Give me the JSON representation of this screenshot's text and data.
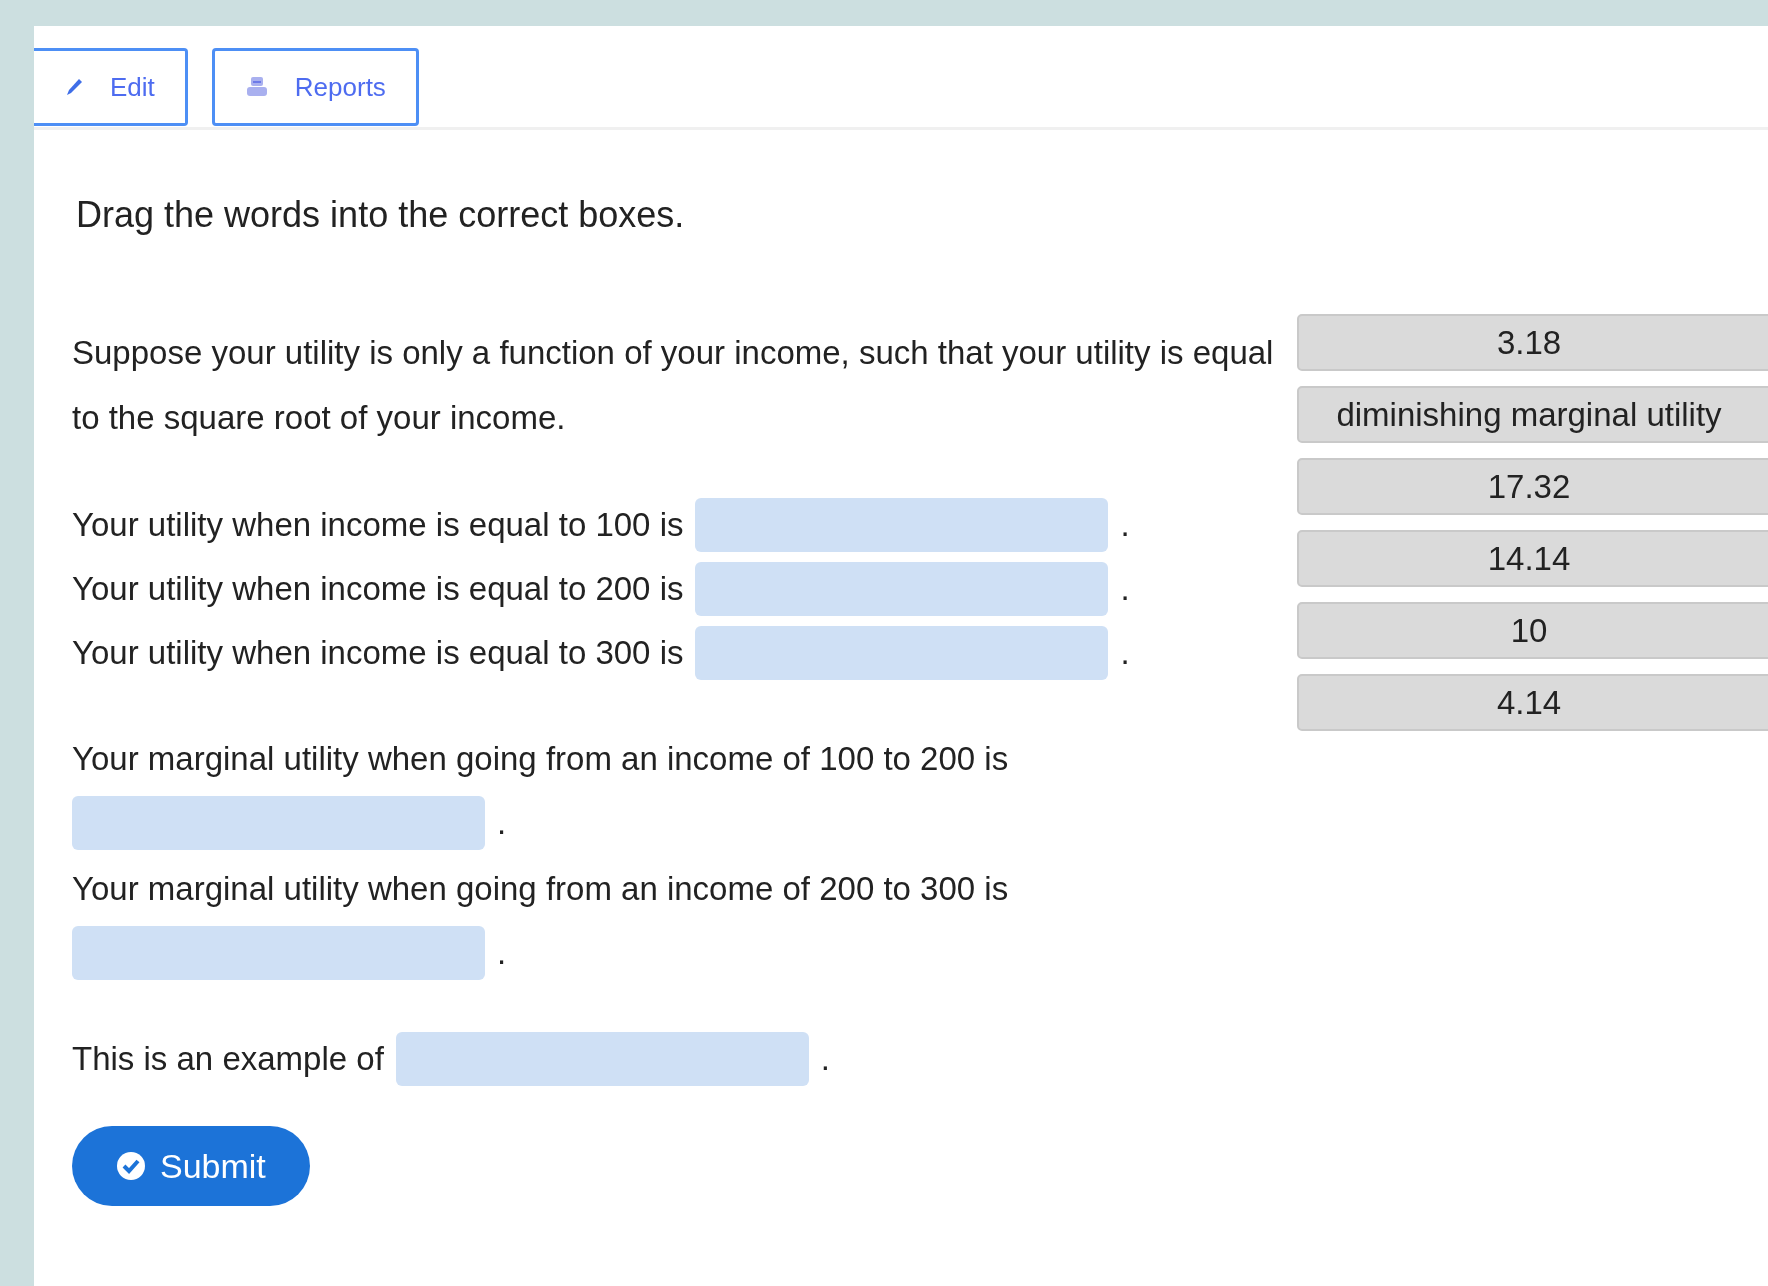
{
  "toolbar": [
    {
      "label": "Edit"
    },
    {
      "label": "Reports"
    }
  ],
  "instruction": "Drag the words into the correct boxes.",
  "question": "Suppose your utility is only a function of your income, such that your utility is equal to the square root of your income.",
  "groups": [
    {
      "items": [
        {
          "kind": "inline",
          "prefix": "Your utility when income is equal to 100 is",
          "suffix": "."
        },
        {
          "kind": "inline",
          "prefix": "Your utility when income is equal to 200 is",
          "suffix": "."
        },
        {
          "kind": "inline",
          "prefix": "Your utility when income is equal to 300 is",
          "suffix": "."
        }
      ]
    },
    {
      "items": [
        {
          "kind": "below",
          "prefix": "Your marginal utility when going from an income of 100 to 200 is",
          "suffix": "."
        },
        {
          "kind": "below",
          "prefix": "Your marginal utility when going from an income of 200 to 300 is",
          "suffix": "."
        }
      ]
    },
    {
      "items": [
        {
          "kind": "inline",
          "prefix": "This is an example of",
          "suffix": "."
        }
      ]
    }
  ],
  "word_bank": [
    "3.18",
    "diminishing marginal utility",
    "17.32",
    "14.14",
    "10",
    "4.14"
  ],
  "submit": "Submit"
}
